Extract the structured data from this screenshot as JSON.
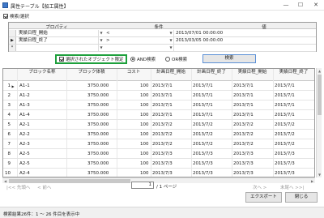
{
  "window": {
    "title": "属性テーブル【船工属性】",
    "minimize": "—",
    "maximize": "☐",
    "close": "✕"
  },
  "search_section": {
    "toggle_label": "検索/選択",
    "toggle_checked": true
  },
  "conditions": {
    "headers": [
      "プロパティ",
      "条件",
      "値"
    ],
    "rows": [
      {
        "property": "実績日程_開始",
        "operator": "<",
        "value": "2013/07/01 00:00:00",
        "selected": false
      },
      {
        "property": "実績日程_終了",
        "operator": ">",
        "value": "2013/03/05 00:00:00",
        "selected": true
      },
      {
        "property": "",
        "operator": "",
        "value": "",
        "selected": false
      }
    ]
  },
  "filters": {
    "selected_only_label": "選択されたオブジェクト限定",
    "selected_only_checked": true,
    "and_label": "AND検索",
    "or_label": "OR検索",
    "mode": "AND",
    "search_button": "検索"
  },
  "results": {
    "headers": [
      "ブロック名称",
      "ブロック体積",
      "コスト",
      "計画日程_開始",
      "計画日程_終了",
      "実績日程_開始",
      "実績日程_終了"
    ],
    "rows": [
      {
        "n": "1",
        "name": "A1-1",
        "volume": "3750.000",
        "cost": "100",
        "ps": "2013/7/1",
        "pe": "2013/7/1",
        "as": "2013/7/1",
        "ae": "2013/7/1"
      },
      {
        "n": "2",
        "name": "A1-2",
        "volume": "3750.000",
        "cost": "100",
        "ps": "2013/7/1",
        "pe": "2013/7/1",
        "as": "2013/7/1",
        "ae": "2013/7/1"
      },
      {
        "n": "3",
        "name": "A1-3",
        "volume": "3750.000",
        "cost": "100",
        "ps": "2013/7/1",
        "pe": "2013/7/1",
        "as": "2013/7/1",
        "ae": "2013/7/1"
      },
      {
        "n": "4",
        "name": "A1-4",
        "volume": "3750.000",
        "cost": "100",
        "ps": "2013/7/1",
        "pe": "2013/7/1",
        "as": "2013/7/1",
        "ae": "2013/7/1"
      },
      {
        "n": "5",
        "name": "A2-1",
        "volume": "3750.000",
        "cost": "100",
        "ps": "2013/7/2",
        "pe": "2013/7/2",
        "as": "2013/7/2",
        "ae": "2013/7/2"
      },
      {
        "n": "6",
        "name": "A2-2",
        "volume": "3750.000",
        "cost": "100",
        "ps": "2013/7/2",
        "pe": "2013/7/2",
        "as": "2013/7/2",
        "ae": "2013/7/2"
      },
      {
        "n": "7",
        "name": "A2-3",
        "volume": "3750.000",
        "cost": "100",
        "ps": "2013/7/2",
        "pe": "2013/7/2",
        "as": "2013/7/2",
        "ae": "2013/7/2"
      },
      {
        "n": "8",
        "name": "A2-5",
        "volume": "3750.000",
        "cost": "100",
        "ps": "2013/7/3",
        "pe": "2013/7/3",
        "as": "2013/7/3",
        "ae": "2013/7/3"
      },
      {
        "n": "9",
        "name": "A2-5",
        "volume": "3750.000",
        "cost": "100",
        "ps": "2013/7/3",
        "pe": "2013/7/3",
        "as": "2013/7/3",
        "ae": "2013/7/3"
      },
      {
        "n": "10",
        "name": "A2-4",
        "volume": "3750.000",
        "cost": "100",
        "ps": "2013/7/3",
        "pe": "2013/7/3",
        "as": "2013/7/3",
        "ae": "2013/7/3"
      }
    ]
  },
  "pager": {
    "first": "|<< 先頭へ",
    "prev": "< 前へ",
    "page": "1",
    "total": "/ 1 ページ",
    "next": "次へ >",
    "last": "末尾へ >>|"
  },
  "actions": {
    "export": "エクスポート",
    "close": "閉じる"
  },
  "status": "検索結果26件：1 ～ 26 件目を表示中"
}
